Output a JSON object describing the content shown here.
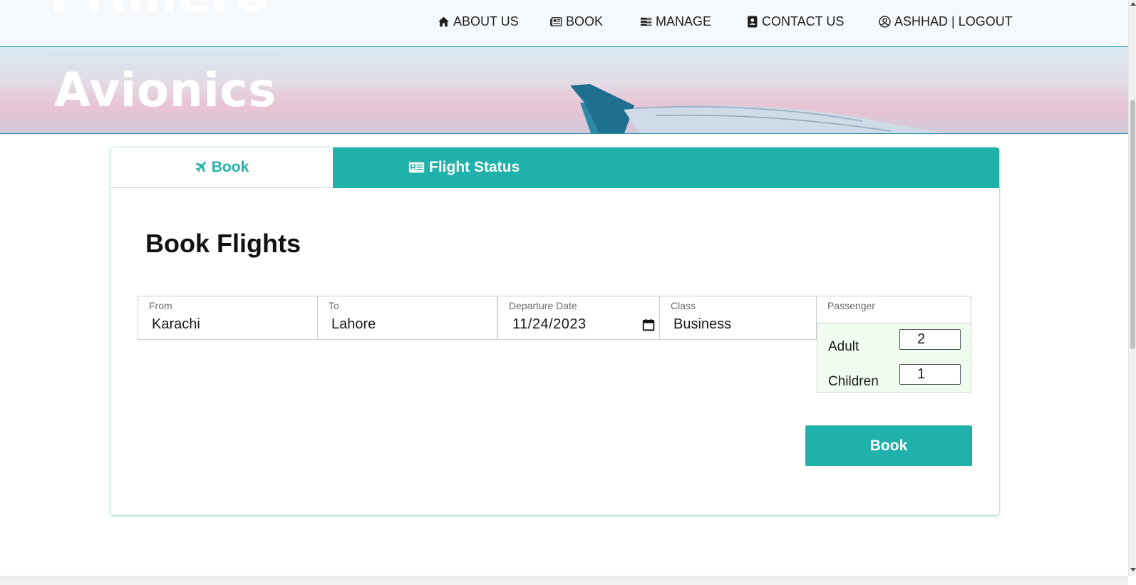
{
  "brand": {
    "line1": "Primero",
    "line2": "Avionics"
  },
  "nav": [
    {
      "label": "ABOUT US",
      "icon": "home-icon"
    },
    {
      "label": "BOOK",
      "icon": "newspaper-icon"
    },
    {
      "label": "MANAGE",
      "icon": "list-icon"
    },
    {
      "label": "CONTACT US",
      "icon": "contact-book-icon"
    },
    {
      "label": "ASHHAD | LOGOUT",
      "icon": "user-circle-icon"
    }
  ],
  "tabs": [
    {
      "label": "Book",
      "icon": "plane-icon",
      "active": true
    },
    {
      "label": "Flight Status",
      "icon": "id-card-icon",
      "active": false
    }
  ],
  "form": {
    "title": "Book Flights",
    "from": {
      "label": "From",
      "value": "Karachi"
    },
    "to": {
      "label": "To",
      "value": "Lahore"
    },
    "departure": {
      "label": "Departure Date",
      "value": "11/24/2023"
    },
    "class": {
      "label": "Class",
      "value": "Business"
    },
    "passenger": {
      "label": "Passenger",
      "adult_label": "Adult",
      "adult_value": "2",
      "children_label": "Children",
      "children_value": "1"
    },
    "submit_label": "Book"
  },
  "colors": {
    "accent": "#20b2aa",
    "panel": "#f0fcf0",
    "border": "#cfcfcf"
  }
}
